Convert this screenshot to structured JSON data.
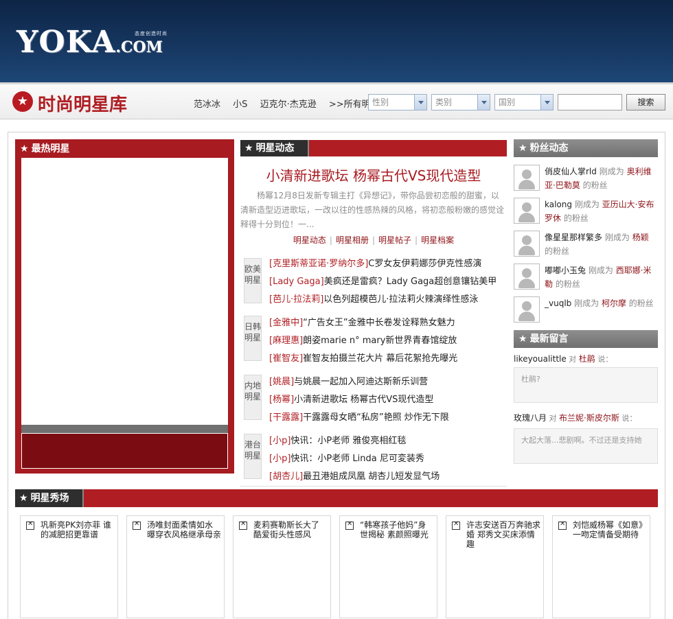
{
  "header": {
    "logo_main": "YOKA",
    "logo_com": ".COM",
    "logo_tagline": "态度创造时尚"
  },
  "subheader": {
    "title": "时尚明星库",
    "quick_links": [
      "范冰冰",
      "小S",
      "迈克尔·杰克逊",
      ">>所有明星"
    ],
    "filters": [
      {
        "placeholder": "性别"
      },
      {
        "placeholder": "类别"
      },
      {
        "placeholder": "国别"
      }
    ],
    "search_button": "搜索"
  },
  "hottest": {
    "title": "最热明星"
  },
  "news": {
    "title": "明星动态",
    "headline": "小清新进歌坛 杨幂古代VS现代造型",
    "summary": "杨幂12月8日发新专辑主打《异想记》，带你品尝初恋般的甜蜜，以清新造型迈进歌坛，一改以往的性感热辣的风格，将初恋般粉嫩的感觉诠释得十分到位！一...",
    "links": [
      "明星动态",
      "明星相册",
      "明星帖子",
      "明星档案"
    ],
    "categories": [
      {
        "label": "欧美明星",
        "items": [
          {
            "tag": "[克里斯蒂亚诺·罗纳尔多]",
            "text": "C罗女友伊莉娜莎伊克性感演"
          },
          {
            "tag": "[Lady Gaga]",
            "text": "美疯还是雷疯？Lady Gaga超创意镶钻美甲"
          },
          {
            "tag": "[芭儿·拉法莉]",
            "text": "以色列超模芭儿·拉法莉火辣演绎性感泳"
          }
        ]
      },
      {
        "label": "日韩明星",
        "items": [
          {
            "tag": "[金雅中]",
            "text": "“广告女王”金雅中长卷发诠释熟女魅力"
          },
          {
            "tag": "[麻理惠]",
            "text": "朗姿marie n° mary新世界青春馆绽放"
          },
          {
            "tag": "[崔智友]",
            "text": "崔智友拍摄兰花大片 幕后花絮抢先曝光"
          }
        ]
      },
      {
        "label": "内地明星",
        "items": [
          {
            "tag": "[姚晨]",
            "text": "与姚晨一起加入阿迪达斯新乐训营"
          },
          {
            "tag": "[杨幂]",
            "text": "小清新进歌坛 杨幂古代VS现代造型"
          },
          {
            "tag": "[干露露]",
            "text": "干露露母女晒“私房”艳照 炒作无下限"
          }
        ]
      },
      {
        "label": "港台明星",
        "items": [
          {
            "tag": "[小p]",
            "text": "快讯：小P老师 雅俊亮相红毯"
          },
          {
            "tag": "[小p]",
            "text": "快讯：小P老师 Linda 尼可変装秀"
          },
          {
            "tag": "[胡杏儿]",
            "text": "最丑港姐成凤凰 胡杏儿短发显气场"
          }
        ]
      }
    ]
  },
  "fans": {
    "title": "粉丝动态",
    "became": "刚成为",
    "suffix": "的粉丝",
    "items": [
      {
        "user": "俏皮仙人掌rld",
        "star": "奥利维亚·巴勒莫"
      },
      {
        "user": "kalong",
        "star": "亚历山大·安布罗休"
      },
      {
        "user": "像星星那样繁多",
        "star": "杨颖"
      },
      {
        "user": "嘟嘟小玉兔",
        "star": "西耶娜·米勒"
      },
      {
        "user": "_vuqlb",
        "star": "柯尔摩"
      }
    ]
  },
  "messages": {
    "title": "最新留言",
    "to": "对",
    "said": "说：",
    "items": [
      {
        "user": "likeyoualittle",
        "star": "杜鹃",
        "text": "杜鹃?"
      },
      {
        "user": "玫瑰八月",
        "star": "布兰妮·斯皮尔斯",
        "text": "大起大落...悲剧啊。不过还是支持她"
      }
    ]
  },
  "show": {
    "title": "明星秀场",
    "cards": [
      "巩新亮PK刘亦菲 谁的减肥招更靠谱",
      "汤唯封面柔情如水 曝穿衣风格继承母亲",
      "麦莉赛勒斯长大了 酷爱街头性感风",
      "“韩寒孩子他妈”身世揭秘 素颜照曝光",
      "许志安送百万奔驰求婚 郑秀文买床添情趣",
      "刘恺威杨幂《如意》一吻定情备受期待"
    ]
  }
}
